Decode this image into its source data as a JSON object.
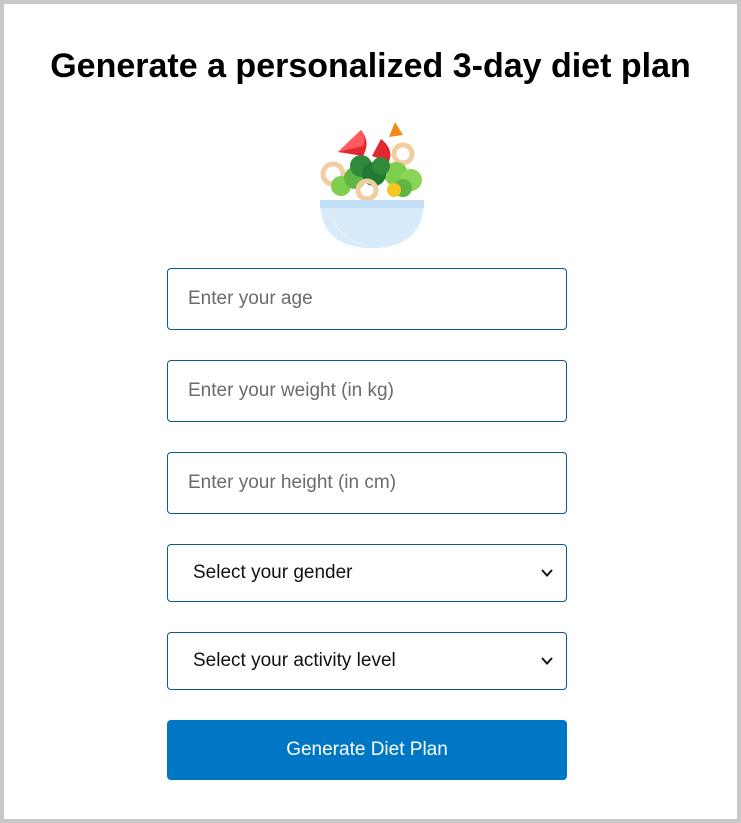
{
  "page": {
    "title": "Generate a personalized 3-day diet plan",
    "hero_icon": "salad-bowl-icon"
  },
  "form": {
    "age": {
      "placeholder": "Enter your age",
      "value": ""
    },
    "weight": {
      "placeholder": "Enter your weight (in kg)",
      "value": ""
    },
    "height": {
      "placeholder": "Enter your height (in cm)",
      "value": ""
    },
    "gender": {
      "selected": "Select your gender"
    },
    "activity": {
      "selected": "Select your activity level"
    },
    "submit_label": "Generate Diet Plan"
  },
  "colors": {
    "accent": "#0077c4",
    "field_border": "#0a5a8a",
    "frame_border": "#c8c8c8"
  }
}
